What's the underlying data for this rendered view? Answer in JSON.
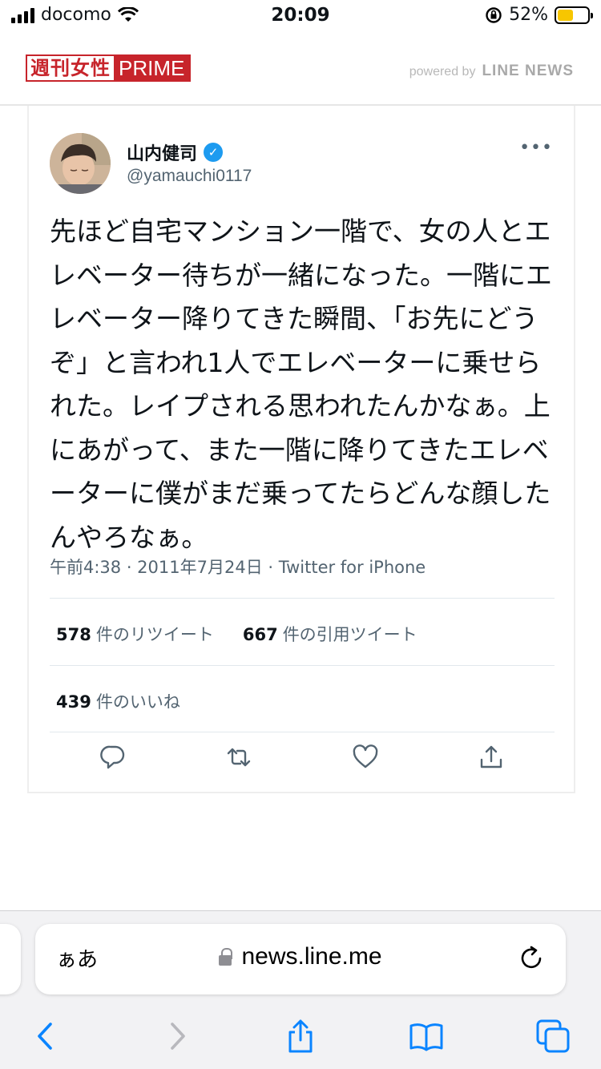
{
  "status_bar": {
    "carrier": "docomo",
    "time": "20:09",
    "battery_percent": "52%",
    "battery_level": 0.52,
    "signal_bars": 4
  },
  "site_header": {
    "logo_jp": "週刊女性",
    "logo_en": "PRIME",
    "powered_by": "powered by",
    "powered_brand": "LINE NEWS"
  },
  "tweet": {
    "user_name": "山内健司",
    "verified_mark": "✓",
    "handle": "@yamauchi0117",
    "more_icon": "•••",
    "text": "先ほど自宅マンション一階で、女の人とエレベーター待ちが一緒になった。一階にエレベーター降りてきた瞬間、「お先にどうぞ」と言われ1人でエレベーターに乗せられた。レイプされる思われたんかなぁ。上にあがって、また一階に降りてきたエレベーターに僕がまだ乗ってたらどんな顔したんやろなぁ。",
    "meta": "午前4:38 · 2011年7月24日 · Twitter for iPhone",
    "retweets_count": "578",
    "retweets_label": "件のリツイート",
    "quotes_count": "667",
    "quotes_label": "件の引用ツイート",
    "likes_count": "439",
    "likes_label": "件のいいね",
    "actions": [
      "reply-icon",
      "retweet-icon",
      "like-icon",
      "share-icon"
    ]
  },
  "browser": {
    "aa_label": "ぁあ",
    "url": "news.line.me",
    "toolbar": [
      "back-icon",
      "forward-icon",
      "share-icon",
      "bookmarks-icon",
      "tabs-icon"
    ]
  },
  "colors": {
    "accent_blue": "#1d9bf0",
    "safari_blue": "#0a84ff",
    "logo_red": "#c7242b",
    "battery_yellow": "#f7c600"
  }
}
